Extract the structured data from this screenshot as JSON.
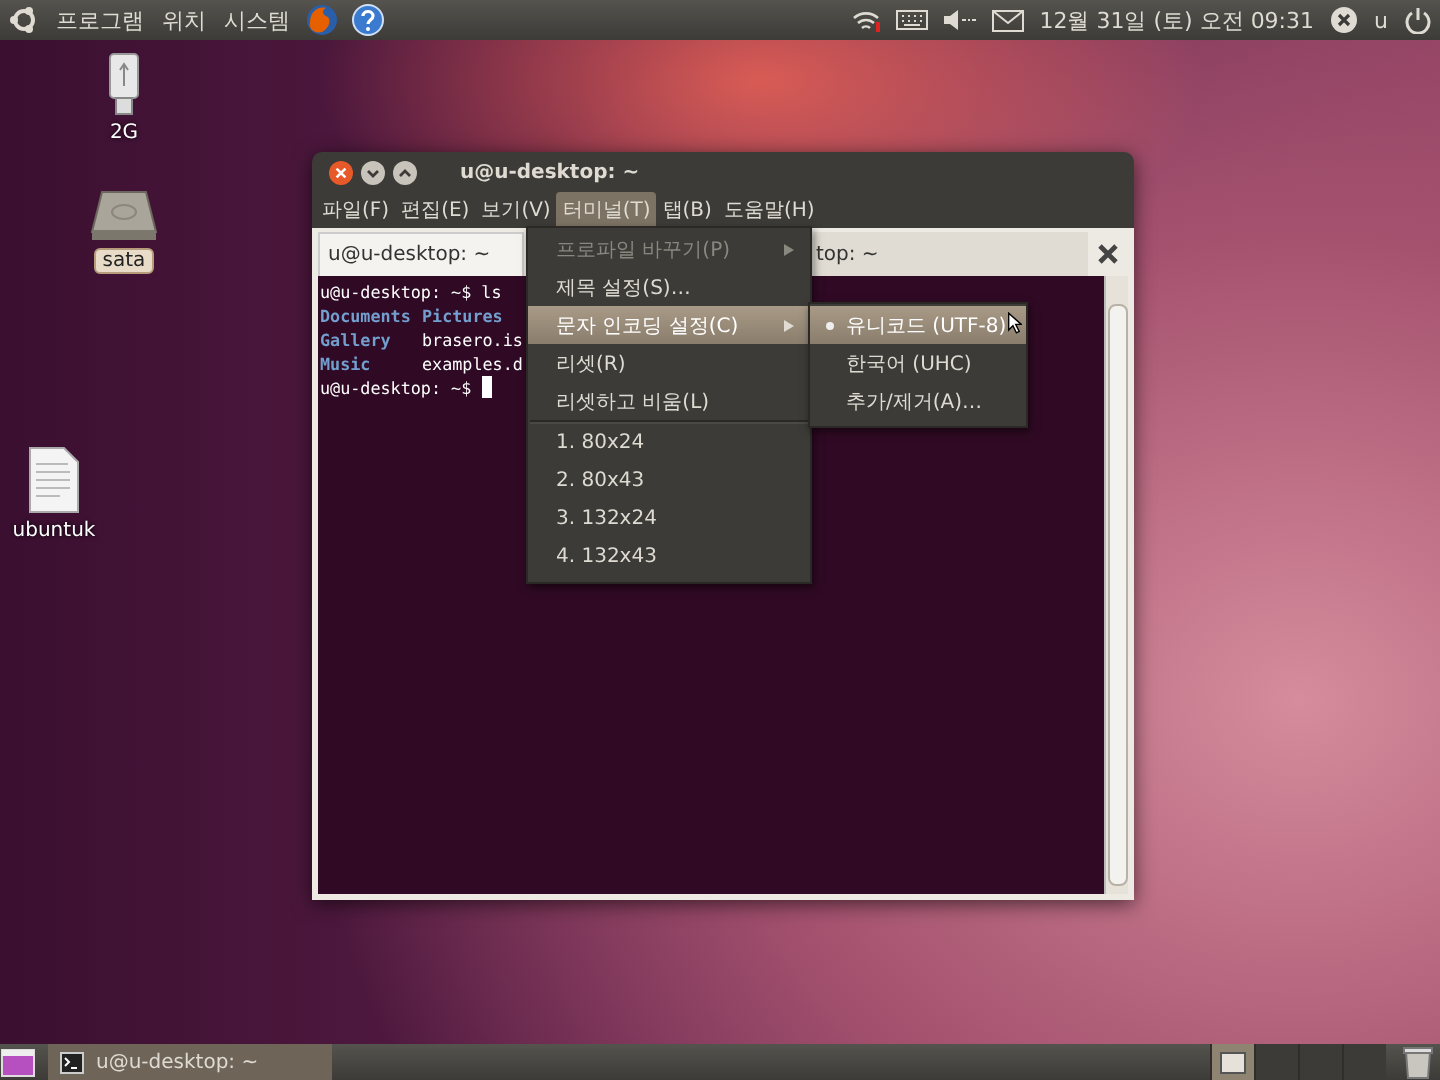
{
  "top_panel": {
    "menus": [
      "프로그램",
      "위치",
      "시스템"
    ],
    "clock": "12월 31일 (토) 오전 09:31",
    "user": "u"
  },
  "desktop_icons": [
    {
      "label": "2G",
      "kind": "usb",
      "selected": false
    },
    {
      "label": "sata",
      "kind": "disk",
      "selected": true
    },
    {
      "label": "ubuntuk",
      "kind": "file",
      "selected": false
    }
  ],
  "window": {
    "title": "u@u-desktop: ~",
    "menubar": [
      {
        "label": "파일(F)",
        "selected": false
      },
      {
        "label": "편집(E)",
        "selected": false
      },
      {
        "label": "보기(V)",
        "selected": false
      },
      {
        "label": "터미널(T)",
        "selected": true
      },
      {
        "label": "탭(B)",
        "selected": false
      },
      {
        "label": "도움말(H)",
        "selected": false
      }
    ],
    "tabs": [
      {
        "label": "u@u-desktop: ~",
        "selected": true
      },
      {
        "label": "top: ~",
        "selected": false
      }
    ],
    "terminal_lines": [
      {
        "kind": "prompt",
        "text": "u@u-desktop: ~$ ls",
        "cursor": false
      },
      {
        "kind": "listing",
        "cells": [
          {
            "text": "Documents",
            "kind": "dir"
          },
          {
            "text": "Pictures",
            "kind": "dir"
          }
        ]
      },
      {
        "kind": "listing",
        "cells": [
          {
            "text": "Gallery",
            "kind": "dir"
          },
          {
            "text": "brasero.is",
            "kind": "file"
          }
        ]
      },
      {
        "kind": "listing",
        "cells": [
          {
            "text": "Music",
            "kind": "dir"
          },
          {
            "text": "examples.d",
            "kind": "file"
          }
        ]
      },
      {
        "kind": "prompt",
        "text": "u@u-desktop: ~$",
        "cursor": true
      }
    ]
  },
  "menu": {
    "items": [
      {
        "kind": "submenu",
        "label": "프로파일 바꾸기(P)",
        "disabled": true,
        "selected": false
      },
      {
        "kind": "item",
        "label": "제목 설정(S)…",
        "disabled": false,
        "selected": false
      },
      {
        "kind": "submenu",
        "label": "문자 인코딩 설정(C)",
        "disabled": false,
        "selected": true
      },
      {
        "kind": "item",
        "label": "리셋(R)",
        "disabled": false,
        "selected": false
      },
      {
        "kind": "item",
        "label": "리셋하고 비움(L)",
        "disabled": false,
        "selected": false
      },
      {
        "kind": "separator"
      },
      {
        "kind": "item",
        "label": "1. 80x24",
        "disabled": false,
        "selected": false
      },
      {
        "kind": "item",
        "label": "2. 80x43",
        "disabled": false,
        "selected": false
      },
      {
        "kind": "item",
        "label": "3. 132x24",
        "disabled": false,
        "selected": false
      },
      {
        "kind": "item",
        "label": "4. 132x43",
        "disabled": false,
        "selected": false
      }
    ]
  },
  "submenu": {
    "items": [
      {
        "label": "유니코드 (UTF-8)",
        "selected": true
      },
      {
        "label": "한국어 (UHC)",
        "selected": false
      },
      {
        "label": "추가/제거(A)…",
        "selected": false
      }
    ]
  },
  "bottom_panel": {
    "windows": [
      {
        "label": "u@u-desktop: ~",
        "selected": false
      }
    ],
    "workspaces": [
      {
        "selected": true
      },
      {
        "selected": false
      },
      {
        "selected": false
      },
      {
        "selected": false
      }
    ]
  }
}
